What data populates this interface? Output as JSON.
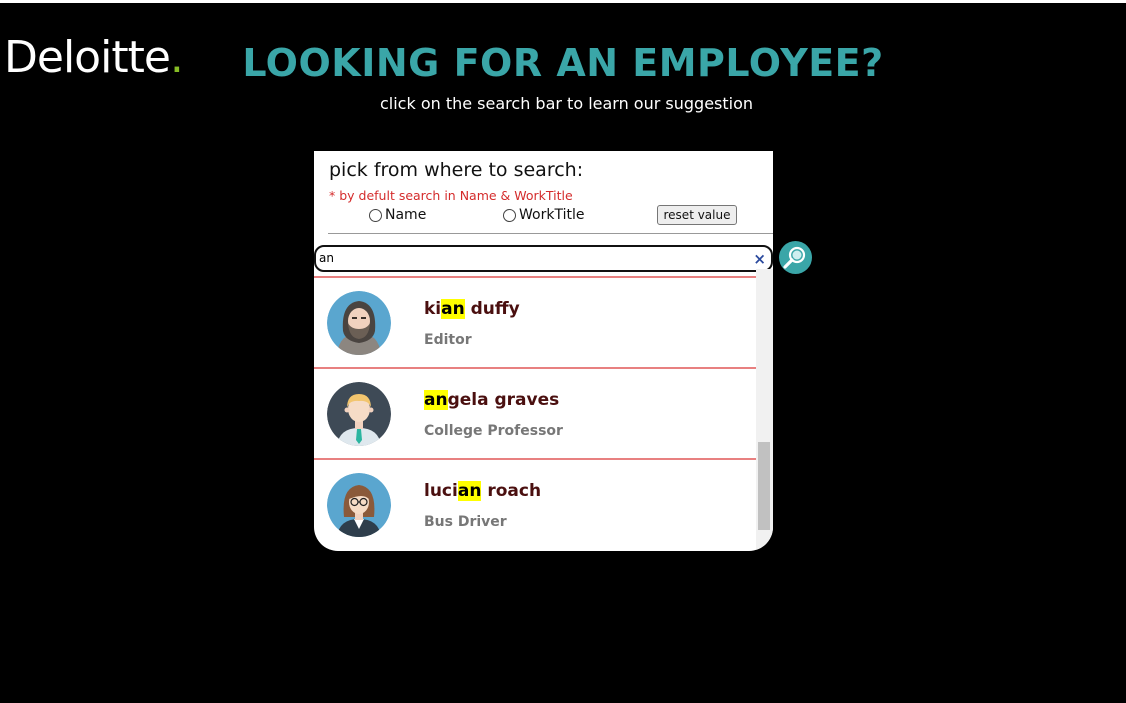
{
  "logo": {
    "text": "Deloitte",
    "dot": "."
  },
  "header": {
    "title": "LOOKING FOR AN EMPLOYEE?",
    "subtitle": "click on the search bar to learn our suggestion"
  },
  "filter": {
    "heading": "pick from where to search:",
    "note": "* by defult search in Name & WorkTitle",
    "options": [
      {
        "label": "Name",
        "checked": false
      },
      {
        "label": "WorkTitle",
        "checked": false
      }
    ],
    "reset_label": "reset value"
  },
  "search": {
    "value": "an",
    "clear_icon": "×",
    "button_icon": "search-icon"
  },
  "results": [
    {
      "name_before": "ki",
      "name_match": "an",
      "name_after": " duffy",
      "title": "Editor",
      "avatar": "hooded-bearded-man"
    },
    {
      "name_before": "",
      "name_match": "an",
      "name_after": "gela graves",
      "title": "College Professor",
      "avatar": "blond-man-tie"
    },
    {
      "name_before": "luci",
      "name_match": "an",
      "name_after": " roach",
      "title": "Bus Driver",
      "avatar": "woman-glasses"
    }
  ],
  "colors": {
    "accent": "#3aa6a8",
    "logo_dot": "#86bc25",
    "note": "#d42b2b",
    "highlight": "#ffff00",
    "name": "#4a0f0f",
    "divider": "#e88080"
  }
}
